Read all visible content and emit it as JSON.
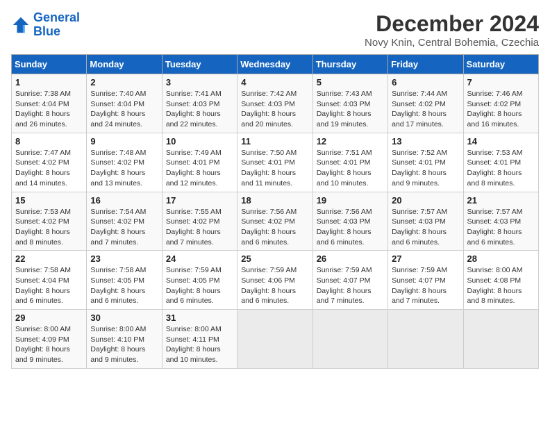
{
  "logo": {
    "line1": "General",
    "line2": "Blue"
  },
  "title": "December 2024",
  "subtitle": "Novy Knin, Central Bohemia, Czechia",
  "weekdays": [
    "Sunday",
    "Monday",
    "Tuesday",
    "Wednesday",
    "Thursday",
    "Friday",
    "Saturday"
  ],
  "weeks": [
    [
      {
        "day": "1",
        "info": "Sunrise: 7:38 AM\nSunset: 4:04 PM\nDaylight: 8 hours\nand 26 minutes."
      },
      {
        "day": "2",
        "info": "Sunrise: 7:40 AM\nSunset: 4:04 PM\nDaylight: 8 hours\nand 24 minutes."
      },
      {
        "day": "3",
        "info": "Sunrise: 7:41 AM\nSunset: 4:03 PM\nDaylight: 8 hours\nand 22 minutes."
      },
      {
        "day": "4",
        "info": "Sunrise: 7:42 AM\nSunset: 4:03 PM\nDaylight: 8 hours\nand 20 minutes."
      },
      {
        "day": "5",
        "info": "Sunrise: 7:43 AM\nSunset: 4:03 PM\nDaylight: 8 hours\nand 19 minutes."
      },
      {
        "day": "6",
        "info": "Sunrise: 7:44 AM\nSunset: 4:02 PM\nDaylight: 8 hours\nand 17 minutes."
      },
      {
        "day": "7",
        "info": "Sunrise: 7:46 AM\nSunset: 4:02 PM\nDaylight: 8 hours\nand 16 minutes."
      }
    ],
    [
      {
        "day": "8",
        "info": "Sunrise: 7:47 AM\nSunset: 4:02 PM\nDaylight: 8 hours\nand 14 minutes."
      },
      {
        "day": "9",
        "info": "Sunrise: 7:48 AM\nSunset: 4:02 PM\nDaylight: 8 hours\nand 13 minutes."
      },
      {
        "day": "10",
        "info": "Sunrise: 7:49 AM\nSunset: 4:01 PM\nDaylight: 8 hours\nand 12 minutes."
      },
      {
        "day": "11",
        "info": "Sunrise: 7:50 AM\nSunset: 4:01 PM\nDaylight: 8 hours\nand 11 minutes."
      },
      {
        "day": "12",
        "info": "Sunrise: 7:51 AM\nSunset: 4:01 PM\nDaylight: 8 hours\nand 10 minutes."
      },
      {
        "day": "13",
        "info": "Sunrise: 7:52 AM\nSunset: 4:01 PM\nDaylight: 8 hours\nand 9 minutes."
      },
      {
        "day": "14",
        "info": "Sunrise: 7:53 AM\nSunset: 4:01 PM\nDaylight: 8 hours\nand 8 minutes."
      }
    ],
    [
      {
        "day": "15",
        "info": "Sunrise: 7:53 AM\nSunset: 4:02 PM\nDaylight: 8 hours\nand 8 minutes."
      },
      {
        "day": "16",
        "info": "Sunrise: 7:54 AM\nSunset: 4:02 PM\nDaylight: 8 hours\nand 7 minutes."
      },
      {
        "day": "17",
        "info": "Sunrise: 7:55 AM\nSunset: 4:02 PM\nDaylight: 8 hours\nand 7 minutes."
      },
      {
        "day": "18",
        "info": "Sunrise: 7:56 AM\nSunset: 4:02 PM\nDaylight: 8 hours\nand 6 minutes."
      },
      {
        "day": "19",
        "info": "Sunrise: 7:56 AM\nSunset: 4:03 PM\nDaylight: 8 hours\nand 6 minutes."
      },
      {
        "day": "20",
        "info": "Sunrise: 7:57 AM\nSunset: 4:03 PM\nDaylight: 8 hours\nand 6 minutes."
      },
      {
        "day": "21",
        "info": "Sunrise: 7:57 AM\nSunset: 4:03 PM\nDaylight: 8 hours\nand 6 minutes."
      }
    ],
    [
      {
        "day": "22",
        "info": "Sunrise: 7:58 AM\nSunset: 4:04 PM\nDaylight: 8 hours\nand 6 minutes."
      },
      {
        "day": "23",
        "info": "Sunrise: 7:58 AM\nSunset: 4:05 PM\nDaylight: 8 hours\nand 6 minutes."
      },
      {
        "day": "24",
        "info": "Sunrise: 7:59 AM\nSunset: 4:05 PM\nDaylight: 8 hours\nand 6 minutes."
      },
      {
        "day": "25",
        "info": "Sunrise: 7:59 AM\nSunset: 4:06 PM\nDaylight: 8 hours\nand 6 minutes."
      },
      {
        "day": "26",
        "info": "Sunrise: 7:59 AM\nSunset: 4:07 PM\nDaylight: 8 hours\nand 7 minutes."
      },
      {
        "day": "27",
        "info": "Sunrise: 7:59 AM\nSunset: 4:07 PM\nDaylight: 8 hours\nand 7 minutes."
      },
      {
        "day": "28",
        "info": "Sunrise: 8:00 AM\nSunset: 4:08 PM\nDaylight: 8 hours\nand 8 minutes."
      }
    ],
    [
      {
        "day": "29",
        "info": "Sunrise: 8:00 AM\nSunset: 4:09 PM\nDaylight: 8 hours\nand 9 minutes."
      },
      {
        "day": "30",
        "info": "Sunrise: 8:00 AM\nSunset: 4:10 PM\nDaylight: 8 hours\nand 9 minutes."
      },
      {
        "day": "31",
        "info": "Sunrise: 8:00 AM\nSunset: 4:11 PM\nDaylight: 8 hours\nand 10 minutes."
      },
      null,
      null,
      null,
      null
    ]
  ]
}
